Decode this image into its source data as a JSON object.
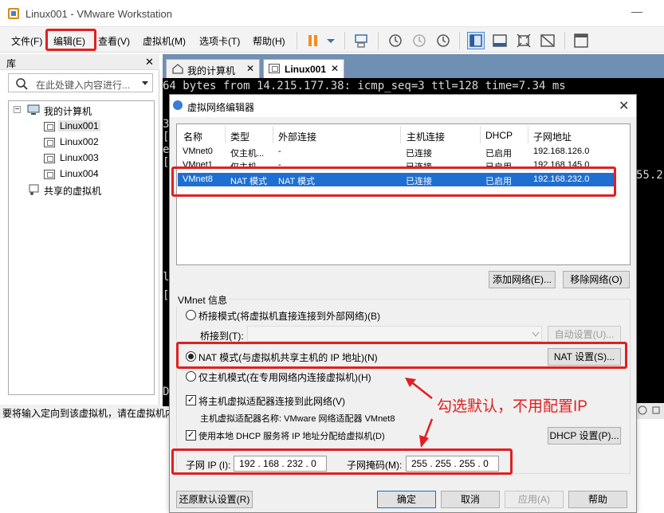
{
  "window": {
    "title": "Linux001 - VMware Workstation",
    "minimize_glyph": "—"
  },
  "menu": [
    "文件(F)",
    "编辑(E)",
    "查看(V)",
    "虚拟机(M)",
    "选项卡(T)",
    "帮助(H)"
  ],
  "library": {
    "title": "库",
    "close_glyph": "✕",
    "search_placeholder": "在此处键入内容进行...",
    "tree": {
      "root": "我的计算机",
      "vms": [
        "Linux001",
        "Linux002",
        "Linux003",
        "Linux004"
      ],
      "shared": "共享的虚拟机"
    }
  },
  "status_bar": {
    "text": "要将输入定向到该虚拟机，请在虚拟机内"
  },
  "tabs": [
    {
      "label": "我的计算机",
      "active": false
    },
    {
      "label": "Linux001",
      "active": true
    }
  ],
  "console": {
    "line1": "64 bytes from 14.215.177.38: icmp_seq=3 ttl=128 time=7.34 ms",
    "fragments": [
      "3",
      "[",
      "e",
      "[",
      "l",
      "[",
      "D"
    ],
    "right_fragment": "55.2"
  },
  "dialog": {
    "title": "虚拟网络编辑器",
    "close_glyph": "✕",
    "columns": [
      "名称",
      "类型",
      "外部连接",
      "主机连接",
      "DHCP",
      "子网地址"
    ],
    "rows": [
      {
        "name": "VMnet0",
        "type": "仅主机...",
        "external": "-",
        "host": "已连接",
        "dhcp": "已启用",
        "subnet": "192.168.126.0",
        "selected": false
      },
      {
        "name": "VMnet1",
        "type": "仅主机...",
        "external": "-",
        "host": "已连接",
        "dhcp": "已启用",
        "subnet": "192.168.145.0",
        "selected": false
      },
      {
        "name": "VMnet8",
        "type": "NAT 模式",
        "external": "NAT 模式",
        "host": "已连接",
        "dhcp": "已启用",
        "subnet": "192.168.232.0",
        "selected": true
      }
    ],
    "add_network": "添加网络(E)...",
    "remove_network": "移除网络(O)",
    "vmnet_info_label": "VMnet 信息",
    "bridge_mode": "桥接模式(将虚拟机直接连接到外部网络)(B)",
    "bridge_to": "桥接到(T):",
    "auto_settings": "自动设置(U)...",
    "nat_mode": "NAT 模式(与虚拟机共享主机的 IP 地址)(N)",
    "nat_settings": "NAT 设置(S)...",
    "host_only": "仅主机模式(在专用网络内连接虚拟机)(H)",
    "connect_adapter": "将主机虚拟适配器连接到此网络(V)",
    "adapter_name": "主机虚拟适配器名称: VMware 网络适配器 VMnet8",
    "use_dhcp": "使用本地 DHCP 服务将 IP 地址分配给虚拟机(D)",
    "dhcp_settings": "DHCP 设置(P)...",
    "subnet_ip_label": "子网 IP (I):",
    "subnet_ip": "192 . 168 . 232 .  0",
    "subnet_mask_label": "子网掩码(M):",
    "subnet_mask": "255 . 255 . 255 .  0",
    "restore_defaults": "还原默认设置(R)",
    "ok": "确定",
    "cancel": "取消",
    "apply": "应用(A)",
    "help": "帮助"
  },
  "annotation": {
    "text": "勾选默认，不用配置IP",
    "color": "#e02020"
  },
  "colors": {
    "selection": "#1e6fd1",
    "tabstrip": "#6f8fb3",
    "pause": "#f09020"
  }
}
